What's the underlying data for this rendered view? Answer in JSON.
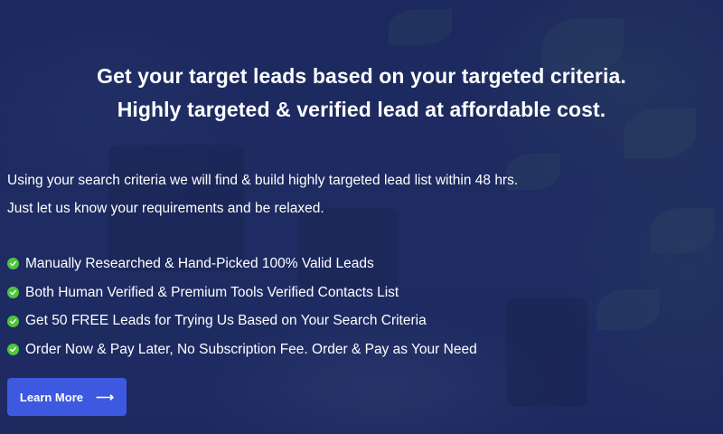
{
  "hero": {
    "headline": [
      "Get your target leads based on your targeted criteria.",
      "Highly targeted & verified lead at affordable cost."
    ],
    "intro": [
      "Using your search criteria we will find & build highly targeted lead list within 48 hrs.",
      "Just let us know your requirements and be relaxed."
    ],
    "features": [
      "Manually Researched & Hand-Picked 100% Valid Leads",
      "Both Human Verified & Premium Tools Verified Contacts List",
      "Get 50 FREE Leads for Trying Us Based on Your Search Criteria",
      "Order Now & Pay Later, No Subscription Fee. Order & Pay as Your Need"
    ],
    "cta_label": "Learn More",
    "cta_icon": "arrow-right-icon"
  },
  "colors": {
    "overlay": "#1e2a62",
    "check": "#4cc63c",
    "button": "#3d59e0",
    "text": "#ffffff"
  }
}
